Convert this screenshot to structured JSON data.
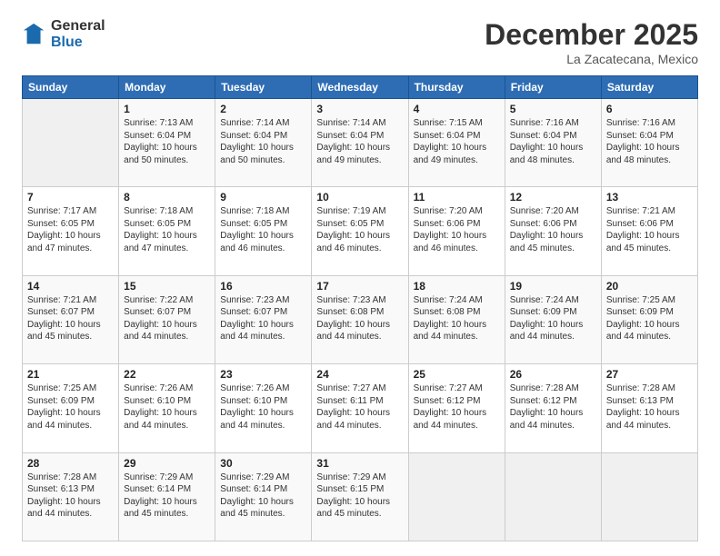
{
  "header": {
    "logo_general": "General",
    "logo_blue": "Blue",
    "month_title": "December 2025",
    "location": "La Zacatecana, Mexico"
  },
  "columns": [
    "Sunday",
    "Monday",
    "Tuesday",
    "Wednesday",
    "Thursday",
    "Friday",
    "Saturday"
  ],
  "weeks": [
    [
      {
        "day": "",
        "info": ""
      },
      {
        "day": "1",
        "info": "Sunrise: 7:13 AM\nSunset: 6:04 PM\nDaylight: 10 hours\nand 50 minutes."
      },
      {
        "day": "2",
        "info": "Sunrise: 7:14 AM\nSunset: 6:04 PM\nDaylight: 10 hours\nand 50 minutes."
      },
      {
        "day": "3",
        "info": "Sunrise: 7:14 AM\nSunset: 6:04 PM\nDaylight: 10 hours\nand 49 minutes."
      },
      {
        "day": "4",
        "info": "Sunrise: 7:15 AM\nSunset: 6:04 PM\nDaylight: 10 hours\nand 49 minutes."
      },
      {
        "day": "5",
        "info": "Sunrise: 7:16 AM\nSunset: 6:04 PM\nDaylight: 10 hours\nand 48 minutes."
      },
      {
        "day": "6",
        "info": "Sunrise: 7:16 AM\nSunset: 6:04 PM\nDaylight: 10 hours\nand 48 minutes."
      }
    ],
    [
      {
        "day": "7",
        "info": "Sunrise: 7:17 AM\nSunset: 6:05 PM\nDaylight: 10 hours\nand 47 minutes."
      },
      {
        "day": "8",
        "info": "Sunrise: 7:18 AM\nSunset: 6:05 PM\nDaylight: 10 hours\nand 47 minutes."
      },
      {
        "day": "9",
        "info": "Sunrise: 7:18 AM\nSunset: 6:05 PM\nDaylight: 10 hours\nand 46 minutes."
      },
      {
        "day": "10",
        "info": "Sunrise: 7:19 AM\nSunset: 6:05 PM\nDaylight: 10 hours\nand 46 minutes."
      },
      {
        "day": "11",
        "info": "Sunrise: 7:20 AM\nSunset: 6:06 PM\nDaylight: 10 hours\nand 46 minutes."
      },
      {
        "day": "12",
        "info": "Sunrise: 7:20 AM\nSunset: 6:06 PM\nDaylight: 10 hours\nand 45 minutes."
      },
      {
        "day": "13",
        "info": "Sunrise: 7:21 AM\nSunset: 6:06 PM\nDaylight: 10 hours\nand 45 minutes."
      }
    ],
    [
      {
        "day": "14",
        "info": "Sunrise: 7:21 AM\nSunset: 6:07 PM\nDaylight: 10 hours\nand 45 minutes."
      },
      {
        "day": "15",
        "info": "Sunrise: 7:22 AM\nSunset: 6:07 PM\nDaylight: 10 hours\nand 44 minutes."
      },
      {
        "day": "16",
        "info": "Sunrise: 7:23 AM\nSunset: 6:07 PM\nDaylight: 10 hours\nand 44 minutes."
      },
      {
        "day": "17",
        "info": "Sunrise: 7:23 AM\nSunset: 6:08 PM\nDaylight: 10 hours\nand 44 minutes."
      },
      {
        "day": "18",
        "info": "Sunrise: 7:24 AM\nSunset: 6:08 PM\nDaylight: 10 hours\nand 44 minutes."
      },
      {
        "day": "19",
        "info": "Sunrise: 7:24 AM\nSunset: 6:09 PM\nDaylight: 10 hours\nand 44 minutes."
      },
      {
        "day": "20",
        "info": "Sunrise: 7:25 AM\nSunset: 6:09 PM\nDaylight: 10 hours\nand 44 minutes."
      }
    ],
    [
      {
        "day": "21",
        "info": "Sunrise: 7:25 AM\nSunset: 6:09 PM\nDaylight: 10 hours\nand 44 minutes."
      },
      {
        "day": "22",
        "info": "Sunrise: 7:26 AM\nSunset: 6:10 PM\nDaylight: 10 hours\nand 44 minutes."
      },
      {
        "day": "23",
        "info": "Sunrise: 7:26 AM\nSunset: 6:10 PM\nDaylight: 10 hours\nand 44 minutes."
      },
      {
        "day": "24",
        "info": "Sunrise: 7:27 AM\nSunset: 6:11 PM\nDaylight: 10 hours\nand 44 minutes."
      },
      {
        "day": "25",
        "info": "Sunrise: 7:27 AM\nSunset: 6:12 PM\nDaylight: 10 hours\nand 44 minutes."
      },
      {
        "day": "26",
        "info": "Sunrise: 7:28 AM\nSunset: 6:12 PM\nDaylight: 10 hours\nand 44 minutes."
      },
      {
        "day": "27",
        "info": "Sunrise: 7:28 AM\nSunset: 6:13 PM\nDaylight: 10 hours\nand 44 minutes."
      }
    ],
    [
      {
        "day": "28",
        "info": "Sunrise: 7:28 AM\nSunset: 6:13 PM\nDaylight: 10 hours\nand 44 minutes."
      },
      {
        "day": "29",
        "info": "Sunrise: 7:29 AM\nSunset: 6:14 PM\nDaylight: 10 hours\nand 45 minutes."
      },
      {
        "day": "30",
        "info": "Sunrise: 7:29 AM\nSunset: 6:14 PM\nDaylight: 10 hours\nand 45 minutes."
      },
      {
        "day": "31",
        "info": "Sunrise: 7:29 AM\nSunset: 6:15 PM\nDaylight: 10 hours\nand 45 minutes."
      },
      {
        "day": "",
        "info": ""
      },
      {
        "day": "",
        "info": ""
      },
      {
        "day": "",
        "info": ""
      }
    ]
  ]
}
